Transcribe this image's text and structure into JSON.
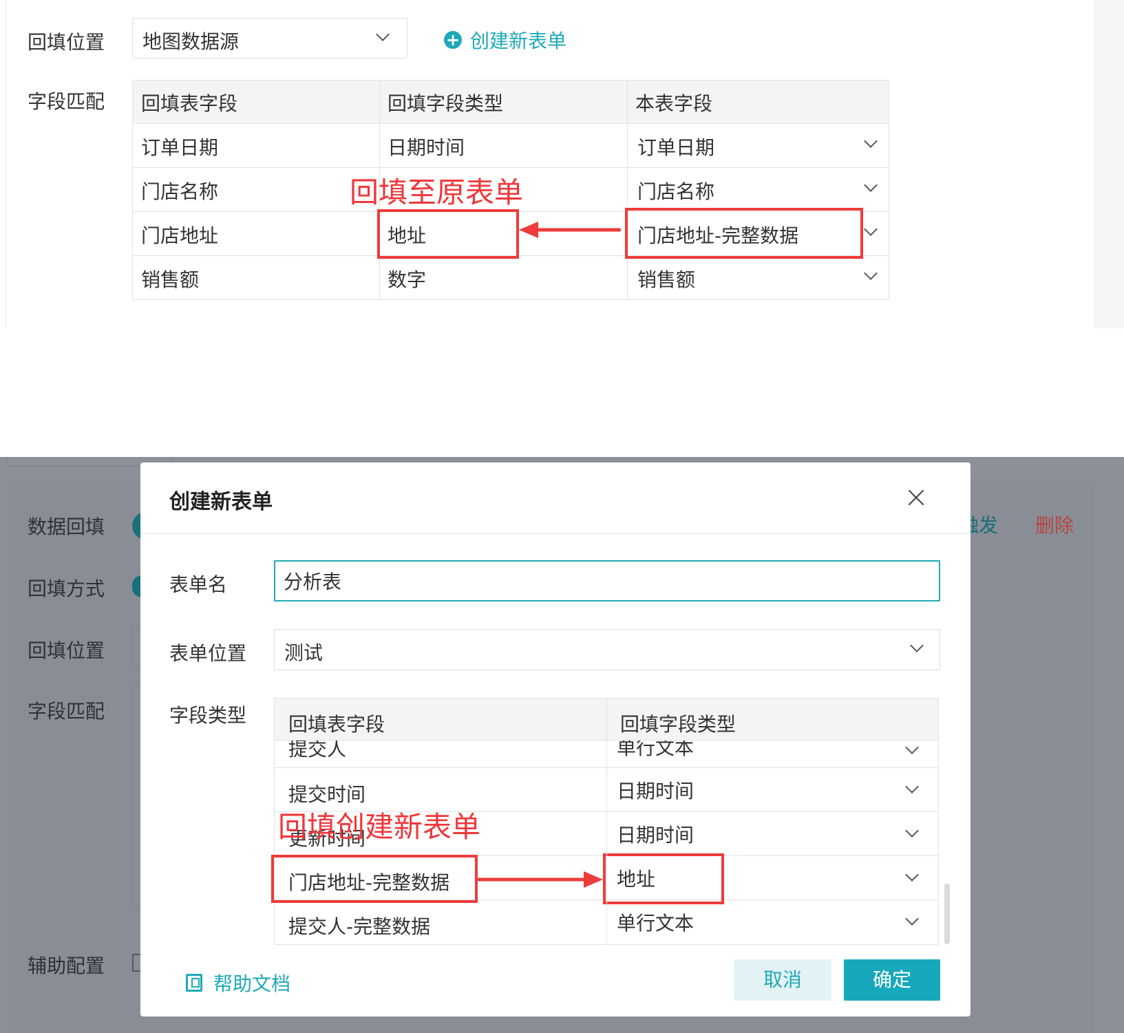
{
  "top": {
    "backfill_position_label": "回填位置",
    "backfill_position_value": "地图数据源",
    "create_link": "创建新表单",
    "field_match_label": "字段匹配",
    "table": {
      "headers": [
        "回填表字段",
        "回填字段类型",
        "本表字段"
      ],
      "rows": [
        [
          "订单日期",
          "日期时间",
          "订单日期"
        ],
        [
          "门店名称",
          "",
          "门店名称"
        ],
        [
          "门店地址",
          "地址",
          "门店地址-完整数据"
        ],
        [
          "销售额",
          "数字",
          "销售额"
        ]
      ]
    },
    "annotation": "回填至原表单"
  },
  "background": {
    "labels": [
      "数据回填",
      "回填方式",
      "回填位置",
      "字段匹配",
      "辅助配置"
    ],
    "trigger_text": "触发",
    "delete_text": "删除"
  },
  "modal": {
    "title": "创建新表单",
    "form_name_label": "表单名",
    "form_name_value": "分析表",
    "form_position_label": "表单位置",
    "form_position_value": "测试",
    "field_type_label": "字段类型",
    "table": {
      "headers": [
        "回填表字段",
        "回填字段类型"
      ],
      "rows": [
        [
          "提交人",
          "单行文本"
        ],
        [
          "提交时间",
          "日期时间"
        ],
        [
          "更新时间",
          "日期时间"
        ],
        [
          "门店地址-完整数据",
          "地址"
        ],
        [
          "提交人-完整数据",
          "单行文本"
        ]
      ]
    },
    "help_text": "帮助文档",
    "cancel_label": "取消",
    "ok_label": "确定",
    "annotation": "回填创建新表单"
  },
  "colors": {
    "accent": "#1fa9b8",
    "annotation_red": "#ee3b3b",
    "overlay": "#8c9098",
    "delete_red": "#b8453f"
  }
}
